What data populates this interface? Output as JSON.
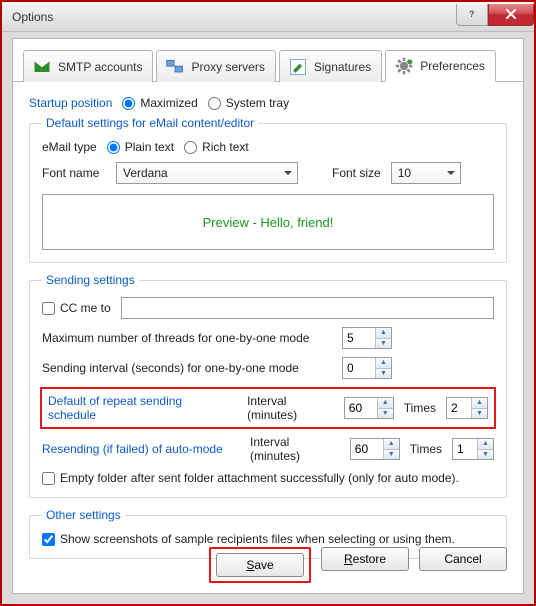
{
  "window": {
    "title": "Options"
  },
  "tabs": {
    "smtp": "SMTP accounts",
    "proxy": "Proxy servers",
    "signatures": "Signatures",
    "preferences": "Preferences"
  },
  "startup": {
    "label": "Startup position",
    "maximized": "Maximized",
    "systray": "System tray"
  },
  "email_group": {
    "legend": "Default settings for eMail content/editor",
    "email_type": "eMail type",
    "plain": "Plain text",
    "rich": "Rich text",
    "font_name_label": "Font name",
    "font_name_value": "Verdana",
    "font_size_label": "Font size",
    "font_size_value": "10",
    "preview_text": "Preview - Hello, friend!"
  },
  "sending": {
    "legend": "Sending settings",
    "cc_label": "CC me to",
    "cc_value": "",
    "max_threads_label": "Maximum number of threads for one-by-one mode",
    "max_threads_value": "5",
    "interval_sec_label": "Sending interval (seconds) for one-by-one mode",
    "interval_sec_value": "0",
    "repeat_label": "Default of repeat sending schedule",
    "interval_min_label": "Interval (minutes)",
    "repeat_interval_value": "60",
    "times_label": "Times",
    "repeat_times_value": "2",
    "resend_label": "Resending (if failed) of auto-mode",
    "resend_interval_value": "60",
    "resend_times_value": "1",
    "empty_folder": "Empty folder after sent folder attachment successfully (only for auto mode)."
  },
  "other": {
    "legend": "Other settings",
    "screenshots": "Show screenshots of sample recipients files when selecting or using them."
  },
  "buttons": {
    "save_pre": "S",
    "save_post": "ave",
    "restore_pre": "R",
    "restore_post": "estore",
    "cancel": "Cancel"
  }
}
